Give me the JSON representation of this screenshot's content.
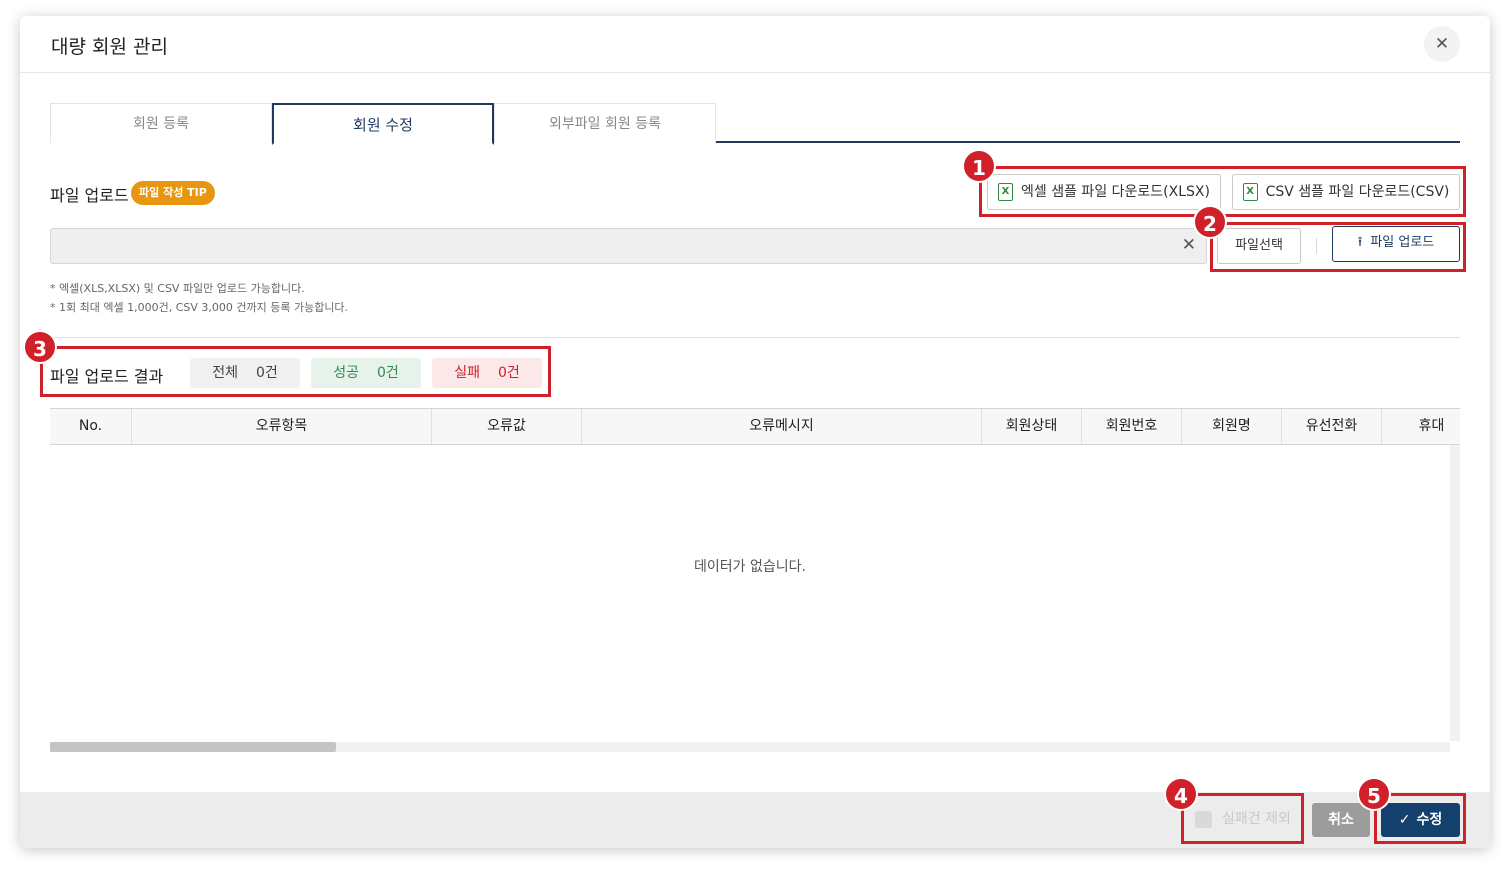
{
  "modal": {
    "title": "대량 회원 관리",
    "close_icon": "close-icon"
  },
  "tabs": [
    {
      "label": "회원 등록",
      "active": false
    },
    {
      "label": "회원 수정",
      "active": true
    },
    {
      "label": "외부파일 회원 등록",
      "active": false
    }
  ],
  "upload": {
    "label": "파일 업로드",
    "tip_badge": "파일 작성 TIP",
    "xlsx_download": "엑셀 샘플 파일 다운로드(XLSX)",
    "csv_download": "CSV 샘플 파일 다운로드(CSV)",
    "file_icon": "excel-file-icon",
    "file_input_value": "",
    "select_button": "파일선택",
    "upload_button": "파일 업로드",
    "upload_icon": "upload-arrow-icon",
    "notes": [
      "* 엑셀(XLS,XLSX) 및 CSV 파일만 업로드 가능합니다.",
      "* 1회 최대 엑셀 1,000건, CSV 3,000 건까지 등록 가능합니다."
    ]
  },
  "result": {
    "label": "파일 업로드 결과",
    "total_label": "전체",
    "total_count": "0건",
    "success_label": "성공",
    "success_count": "0건",
    "fail_label": "실패",
    "fail_count": "0건"
  },
  "table": {
    "columns": [
      "No.",
      "오류항목",
      "오류값",
      "오류메시지",
      "회원상태",
      "회원번호",
      "회원명",
      "유선전화",
      "휴대"
    ],
    "empty_message": "데이터가 없습니다."
  },
  "footer": {
    "exclude_failed": "실패건 제외",
    "exclude_checked": false,
    "cancel": "취소",
    "submit": "수정",
    "check_icon": "check-icon"
  },
  "callouts": [
    "1",
    "2",
    "3",
    "4",
    "5"
  ],
  "colors": {
    "primary": "#14406e",
    "tip_badge": "#e6960f",
    "callout": "#d0202a",
    "success": "#2e8b57",
    "fail": "#d0202a"
  }
}
